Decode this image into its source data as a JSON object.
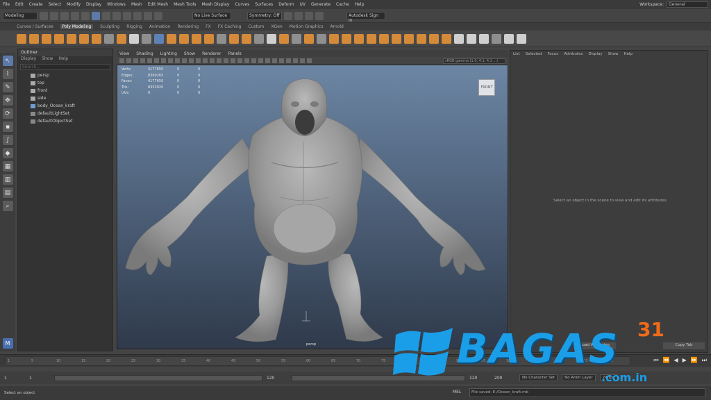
{
  "menubar": {
    "items": [
      "File",
      "Edit",
      "Create",
      "Select",
      "Modify",
      "Display",
      "Windows",
      "Mesh",
      "Edit Mesh",
      "Mesh Tools",
      "Mesh Display",
      "Curves",
      "Surfaces",
      "Deform",
      "UV",
      "Generate",
      "Cache",
      "Help"
    ],
    "workspace_label": "Workspace:",
    "workspace_value": "General"
  },
  "statusline": {
    "mode": "Modeling",
    "symmetry": "No Live Surface",
    "snap": "Symmetry: Off",
    "signin": "Autodesk Sign In"
  },
  "shelf": {
    "tabs": [
      "Curves / Surfaces",
      "Poly Modeling",
      "Sculpting",
      "Rigging",
      "Animation",
      "Rendering",
      "FX",
      "FX Caching",
      "Custom",
      "XGen",
      "Motion Graphics",
      "Arnold"
    ],
    "active_tab": "Poly Modeling"
  },
  "outliner": {
    "title": "Outliner",
    "menu": [
      "Display",
      "Show",
      "Help"
    ],
    "search_placeholder": "Search...",
    "items": [
      "persp",
      "top",
      "front",
      "side",
      "body_Ocean_kraft",
      "defaultLightSet",
      "defaultObjectSet"
    ]
  },
  "viewport": {
    "menu": [
      "View",
      "Shading",
      "Lighting",
      "Show",
      "Renderer",
      "Panels"
    ],
    "camera_field": "sRGB gamma (1.0, 4.1, 4.1 ...)",
    "hud": [
      [
        "Verts:",
        "4177650",
        "0",
        "0"
      ],
      [
        "Edges:",
        "8369265",
        "0",
        "0"
      ],
      [
        "Faces:",
        "4177650",
        "0",
        "0"
      ],
      [
        "Tris:",
        "8353920",
        "0",
        "0"
      ],
      [
        "UVs:",
        "0",
        "0",
        "0"
      ]
    ],
    "viewcube_label": "FRONT",
    "camera_label": "persp"
  },
  "attribute_editor": {
    "menu": [
      "List",
      "Selected",
      "Focus",
      "Attributes",
      "Display",
      "Show",
      "Help"
    ],
    "hint": "Select an object in the scene to view and edit its attributes",
    "load_button": "Load Attributes",
    "copy_button": "Copy Tab"
  },
  "timeslider": {
    "ticks": [
      "1",
      "5",
      "10",
      "15",
      "20",
      "25",
      "30",
      "35",
      "40",
      "45",
      "50",
      "55",
      "60",
      "65",
      "70",
      "75",
      "80",
      "85",
      "90",
      "95",
      "100",
      "105",
      "110",
      "115",
      "120"
    ],
    "current_frame": "1"
  },
  "rangeslider": {
    "start": "1",
    "end_a": "120",
    "end_b": "120",
    "end_c": "200",
    "character_set": "No Character Set",
    "anim_layer": "No Anim Layer",
    "fps": "24 fps"
  },
  "commandline": {
    "hint": "Select an object",
    "mel": "MEL",
    "result": "File saved: E:/Ocean_kraft.mb"
  },
  "watermark": {
    "brand": "BAGAS",
    "number": "31",
    "domain": ".com.in"
  }
}
